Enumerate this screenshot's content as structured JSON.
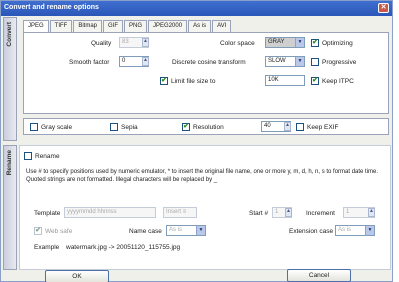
{
  "window": {
    "title": "Convert and rename options",
    "close_glyph": "✕"
  },
  "side_tabs": {
    "convert": "Convert",
    "rename": "Rename"
  },
  "tabs": [
    "JPEG",
    "TIFF",
    "Bitmap",
    "GIF",
    "PNG",
    "JPEG2000",
    "As is",
    "AVI"
  ],
  "jpeg": {
    "quality_label": "Quality",
    "quality_value": "83",
    "smooth_label": "Smooth factor",
    "smooth_value": "0",
    "color_space_label": "Color space",
    "color_space_value": "GRAY",
    "optimizing_label": "Optimizing",
    "optimizing_checked": true,
    "dct_label": "Discrete  cosine  transform",
    "dct_value": "SLOW",
    "progressive_label": "Progressive",
    "progressive_checked": false,
    "limit_label": "Limit file size to",
    "limit_checked": true,
    "limit_value": "10K",
    "keep_itpc_label": "Keep ITPC",
    "keep_itpc_checked": true
  },
  "convert_options": {
    "gray_scale_label": "Gray scale",
    "gray_scale_checked": false,
    "sepia_label": "Sepia",
    "sepia_checked": false,
    "resolution_label": "Resolution",
    "resolution_checked": true,
    "resolution_value": "40",
    "keep_exif_label": "Keep EXIF",
    "keep_exif_checked": false
  },
  "rename": {
    "rename_label": "Rename",
    "rename_checked": false,
    "help_text": "Use # to specify positions used by numeric emulator, * to insert the original file name, one or more y, m, d, h, n, s to format date time. Quoted strings are not formatted. Illegal characters will be replaced by _",
    "template_label": "Template",
    "template_placeholder": "yyyymmdd hhnnss",
    "insert_label": "Insert ≡",
    "start_label": "Start #",
    "start_value": "1",
    "increment_label": "Increment",
    "increment_value": "1",
    "websafe_label": "Web safe",
    "websafe_checked": true,
    "name_case_label": "Name case",
    "name_case_value": "As is",
    "ext_case_label": "Extension case",
    "ext_case_value": "As is",
    "example_label": "Example",
    "example_value": "watermark.jpg -> 20051120_115755.jpg"
  },
  "buttons": {
    "ok": "OK",
    "cancel": "Cancel"
  },
  "icons": {
    "check": "✔",
    "up": "▲",
    "down": "▼",
    "dropdown": "▼"
  }
}
